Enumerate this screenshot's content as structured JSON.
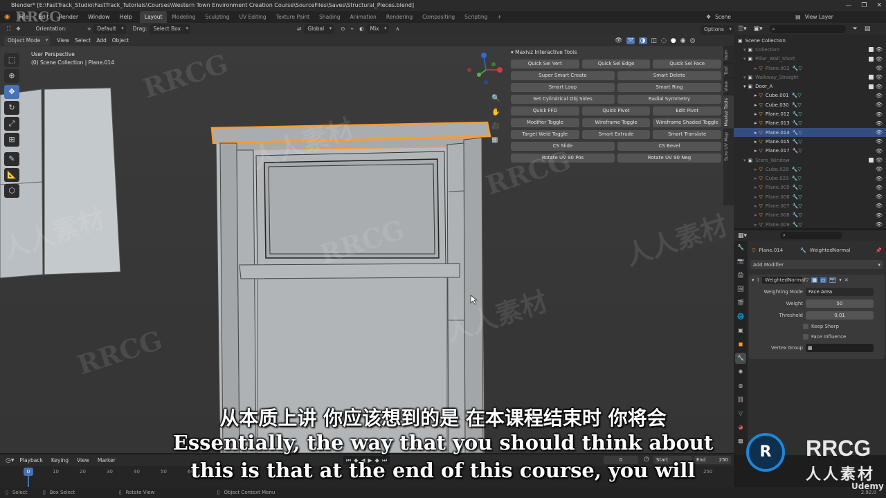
{
  "window": {
    "title": "Blender* [E:\\FastTrack_Studio\\FastTrack_Tutorials\\Courses\\Western Town Environment Creation Course\\SourceFiles\\Saves\\Structural_Pieces.blend]"
  },
  "menu": [
    "File",
    "Edit",
    "Render",
    "Window",
    "Help"
  ],
  "workspaces": [
    "Layout",
    "Modeling",
    "Sculpting",
    "UV Editing",
    "Texture Paint",
    "Shading",
    "Animation",
    "Rendering",
    "Compositing",
    "Scripting"
  ],
  "top_right": {
    "scene": "Scene",
    "view_layer": "View Layer"
  },
  "tool_header": {
    "orientation_label": "Orientation:",
    "orientation_value": "Default",
    "drag_label": "Drag:",
    "drag_value": "Select Box",
    "transform_orientation": "Global",
    "overlay_mix": "Mix",
    "options": "Options"
  },
  "viewport_header": {
    "mode": "Object Mode",
    "menus": [
      "View",
      "Select",
      "Add",
      "Object"
    ]
  },
  "viewport": {
    "perspective": "User Perspective",
    "collection_path": "(0) Scene Collection | Plane.014"
  },
  "npanel": {
    "title": "Maxivz Interactive Tools",
    "rows": [
      [
        "Quick Sel Vert",
        "Quick Sel Edge",
        "Quick Sel Face"
      ],
      [
        "Super Smart Create",
        "Smart Delete"
      ],
      [
        "Smart Loop",
        "Smart Ring"
      ],
      [
        "Set Cylindrical Obj Sides",
        "Radial Symmetry"
      ],
      [
        "Quick FFD",
        "Quick Pivot",
        "Edit Pivot"
      ],
      [
        "Modifier Toggle",
        "Wireframe Toggle",
        "Wireframe Shaded Toggle"
      ],
      [
        "Target Weld Toggle",
        "Smart Extrude",
        "Smart Translate"
      ],
      [
        "CS Slide",
        "CS Bevel"
      ],
      [
        "Rotate UV 90 Pos",
        "Rotate UV 90 Neg"
      ]
    ],
    "side_tabs": [
      "Item",
      "Tool",
      "View",
      "Maxivz Tools",
      "Sure UV Map"
    ]
  },
  "outliner": {
    "root": "Scene Collection",
    "rows": [
      {
        "label": "Collection",
        "dim": true
      },
      {
        "label": "Pillar_Wall_Short",
        "dim": true
      },
      {
        "label": "Plane.002",
        "dim": true
      },
      {
        "label": "Walkway_Straight",
        "dim": true
      },
      {
        "label": "Door_A",
        "dim": false
      },
      {
        "label": "Cube.001",
        "dim": false
      },
      {
        "label": "Cube.030",
        "dim": false
      },
      {
        "label": "Plane.012",
        "dim": false
      },
      {
        "label": "Plane.013",
        "dim": false
      },
      {
        "label": "Plane.014",
        "dim": false,
        "selected": true
      },
      {
        "label": "Plane.015",
        "dim": false
      },
      {
        "label": "Plane.017",
        "dim": false
      },
      {
        "label": "Store_Window",
        "dim": true
      },
      {
        "label": "Cube.028",
        "dim": true
      },
      {
        "label": "Cube.029",
        "dim": true
      },
      {
        "label": "Plane.005",
        "dim": true
      },
      {
        "label": "Plane.006",
        "dim": true
      },
      {
        "label": "Plane.007",
        "dim": true
      },
      {
        "label": "Plane.008",
        "dim": true
      },
      {
        "label": "Plane.009",
        "dim": true
      }
    ]
  },
  "properties": {
    "object": "Plane.014",
    "modifier_ref": "WeightedNormal",
    "add_modifier": "Add Modifier",
    "modifier_name": "WeightedNormal",
    "weighting_mode_label": "Weighting Mode",
    "weighting_mode_value": "Face Area",
    "weight_label": "Weight",
    "weight_value": "50",
    "threshold_label": "Threshold",
    "threshold_value": "0.01",
    "keep_sharp": "Keep Sharp",
    "face_influence": "Face Influence",
    "vertex_group_label": "Vertex Group"
  },
  "timeline": {
    "menus": [
      "Playback",
      "Keying",
      "View",
      "Marker"
    ],
    "current_frame": "0",
    "start_label": "Start",
    "end_label": "End",
    "end_value": "250",
    "ticks": [
      "0",
      "10",
      "20",
      "30",
      "40",
      "50",
      "60",
      "250"
    ]
  },
  "statusbar": {
    "select": "Select",
    "box_select": "Box Select",
    "rotate_view": "Rotate View",
    "context_menu": "Object Context Menu",
    "version": "2.92.0"
  },
  "subtitles": {
    "zh": "从本质上讲 你应该想到的是 在本课程结束时 你将会",
    "en1": "Essentially, the way that you should think about",
    "en2": "this is that at the end of this course, you will"
  },
  "branding": {
    "logo_top": "RRCG",
    "logo_bottom": "人人素材",
    "udemy": "Udemy"
  },
  "watermarks": [
    "RRCG",
    "人人素材"
  ],
  "colors": {
    "accent": "#4772b3",
    "selection_outline": "#ff9a2c",
    "outliner_select": "#334d80"
  }
}
